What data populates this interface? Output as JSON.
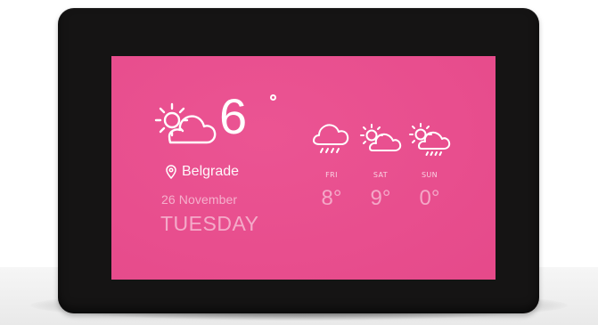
{
  "app": {
    "screen_color": "#ea4b8d",
    "bezel_color": "#151414",
    "text_color": "#ffffff"
  },
  "current": {
    "icon": "sun-cloud-icon",
    "temperature": "6",
    "city": "Belgrade",
    "date": "26 November",
    "weekday": "TUESDAY"
  },
  "forecast": [
    {
      "day": "FRI",
      "temp": "8°",
      "icon": "rain-cloud-icon"
    },
    {
      "day": "SAT",
      "temp": "9°",
      "icon": "sun-cloud-icon"
    },
    {
      "day": "SUN",
      "temp": "0°",
      "icon": "sun-cloud-rain-icon"
    }
  ]
}
